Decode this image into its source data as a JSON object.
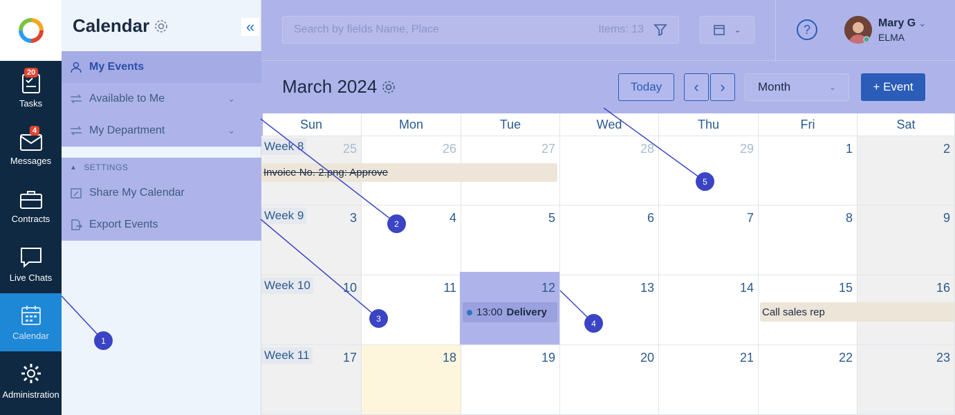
{
  "rail": {
    "items": [
      {
        "label": "Tasks",
        "icon": "tasks-icon",
        "badge": "20"
      },
      {
        "label": "Messages",
        "icon": "messages-icon",
        "badge": "4"
      },
      {
        "label": "Contracts",
        "icon": "briefcase-icon",
        "badge": ""
      },
      {
        "label": "Live Chats",
        "icon": "chat-icon",
        "badge": ""
      },
      {
        "label": "Calendar",
        "icon": "calendar-icon",
        "badge": ""
      },
      {
        "label": "Administration",
        "icon": "gear-icon",
        "badge": ""
      }
    ]
  },
  "sidebar": {
    "title": "Calendar",
    "collapse_glyph": "«",
    "items": [
      {
        "label": "My Events"
      },
      {
        "label": "Available to Me"
      },
      {
        "label": "My Department"
      }
    ],
    "settings_label": "SETTINGS",
    "settings_items": [
      {
        "label": "Share My Calendar"
      },
      {
        "label": "Export Events"
      }
    ]
  },
  "topbar": {
    "search_placeholder": "Search by fields Name, Place",
    "items_count": "Items: 13",
    "help_glyph": "?",
    "user_name": "Mary G",
    "user_org": "ELMA"
  },
  "calendar": {
    "title": "March 2024",
    "today_label": "Today",
    "prev_glyph": "‹",
    "next_glyph": "›",
    "view_select": "Month",
    "add_event_label": "+ Event",
    "weekdays": [
      "Sun",
      "Mon",
      "Tue",
      "Wed",
      "Thu",
      "Fri",
      "Sat"
    ],
    "weeks": [
      {
        "label": "Week 8",
        "days": [
          "25",
          "26",
          "27",
          "28",
          "29",
          "1",
          "2"
        ]
      },
      {
        "label": "Week 9",
        "days": [
          "3",
          "4",
          "5",
          "6",
          "7",
          "8",
          "9"
        ]
      },
      {
        "label": "Week 10",
        "days": [
          "10",
          "11",
          "12",
          "13",
          "14",
          "15",
          "16"
        ]
      },
      {
        "label": "Week 11",
        "days": [
          "17",
          "18",
          "19",
          "20",
          "21",
          "22",
          "23"
        ]
      }
    ],
    "events": {
      "invoice": "Invoice No. 2.png: Approve",
      "delivery_time": "13:00",
      "delivery_title": "Delivery",
      "call": "Call sales rep"
    }
  },
  "callouts": [
    "1",
    "2",
    "3",
    "4",
    "5"
  ]
}
